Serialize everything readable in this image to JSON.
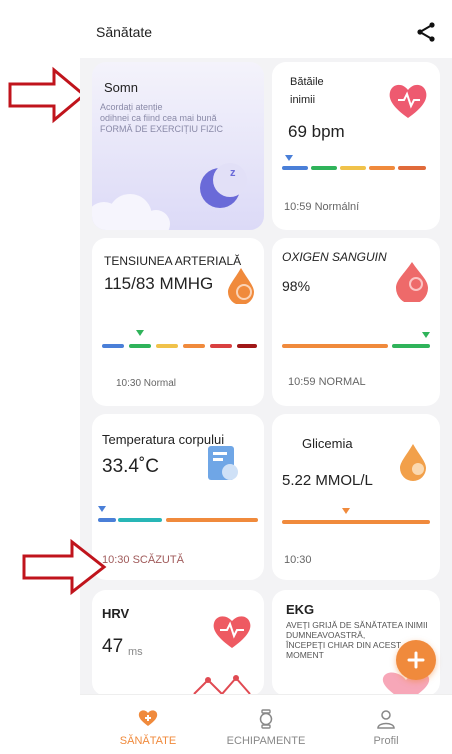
{
  "header": {
    "title": "Sănătate"
  },
  "cards": {
    "sleep": {
      "title": "Somn",
      "line1": "Acordați atenție",
      "line2": "odihnei ca fiind cea mai bună",
      "line3": "FORMĂ DE EXERCIȚIU FIZIC"
    },
    "heart": {
      "title_line1": "Bătăile",
      "title_line2": "inimii",
      "value": "69 bpm",
      "status": "10:59 Normální"
    },
    "bp": {
      "title": "TENSIUNEA ARTERIALĂ",
      "value": "115/83 MMHG",
      "status": "10:30 Normal"
    },
    "oxygen": {
      "title": "OXIGEN SANGUIN",
      "value": "98%",
      "status": "10:59 NORMAL"
    },
    "temp": {
      "title": "Temperatura corpului",
      "value": "33.4˚C",
      "status": "10:30 SCĂZUTĂ"
    },
    "glucose": {
      "title": "Glicemia",
      "value": "5.22 MMOL/L",
      "status": "10:30"
    },
    "hrv": {
      "title": "HRV",
      "value": "47",
      "unit": "ms"
    },
    "ekg": {
      "title": "EKG",
      "line1": "AVEȚI GRIJĂ DE SĂNĂTATEA INIMII",
      "line2": "DUMNEAVOASTRĂ,",
      "line3": "ÎNCEPEȚI CHIAR DIN ACEST",
      "line4": "MOMENT"
    }
  },
  "nav": [
    {
      "label": "SĂNĂTATE",
      "icon": "heart-plus-icon",
      "active": true
    },
    {
      "label": "ECHIPAMENTE",
      "icon": "watch-icon",
      "active": false
    },
    {
      "label": "Profil",
      "icon": "user-icon",
      "active": false
    }
  ],
  "colors": {
    "accent": "#f08a3c",
    "arrow": "#c0141c",
    "blue": "#4a7fd8",
    "green": "#2fb35a",
    "yellow": "#f0c24a",
    "red": "#d94040",
    "darkred": "#a01818",
    "teal": "#28b6b6"
  }
}
